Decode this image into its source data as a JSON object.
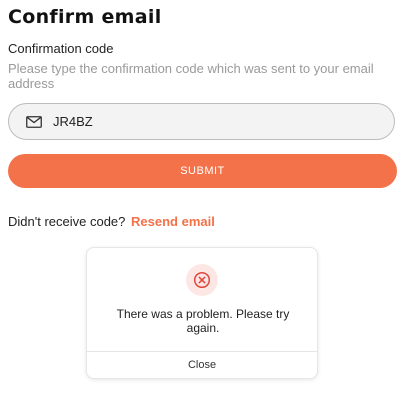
{
  "page": {
    "title": "Confirm email"
  },
  "form": {
    "field_label": "Confirmation code",
    "field_help": "Please type the confirmation code which was sent to your email address",
    "code_value": "JR4BZ",
    "input_icon": "mail-icon",
    "submit_label": "SUBMIT"
  },
  "resend": {
    "prompt": "Didn't receive code?",
    "link_label": "Resend email"
  },
  "dialog": {
    "icon": "error-x-circle-icon",
    "message": "There was a problem. Please try again.",
    "close_label": "Close"
  },
  "colors": {
    "accent": "#f37249",
    "error": "#e2463c",
    "error_bg": "#fde7e5",
    "input_bg": "#f3f3f3",
    "help_text": "#9a9a9a"
  }
}
